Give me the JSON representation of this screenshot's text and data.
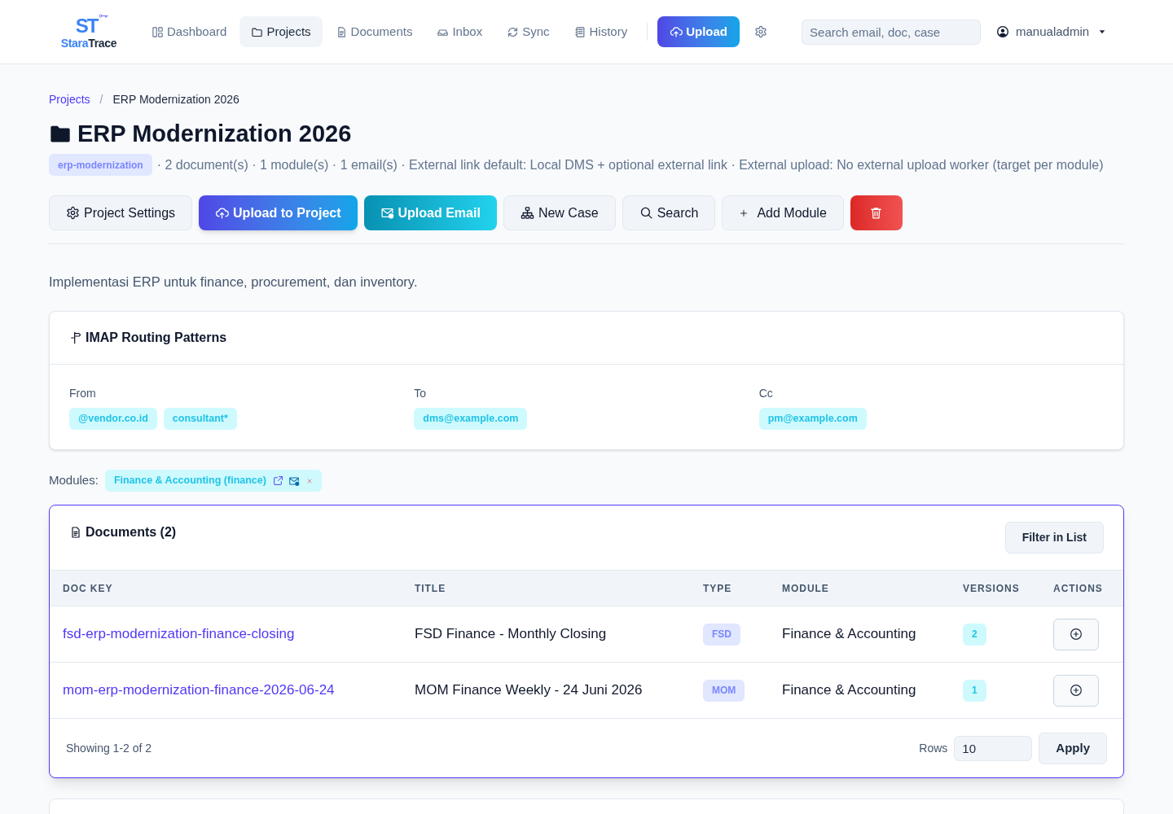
{
  "header": {
    "logo": {
      "mark": "ST",
      "name_parts": [
        {
          "text": "Stara",
          "accent": true
        },
        {
          "text": "Trace",
          "accent": false
        }
      ]
    },
    "nav": [
      {
        "kind": "dashboard",
        "label": "Dashboard",
        "selected": false
      },
      {
        "kind": "projects",
        "label": "Projects",
        "selected": true
      },
      {
        "kind": "documents",
        "label": "Documents",
        "selected": false
      },
      {
        "kind": "inbox",
        "label": "Inbox",
        "selected": false
      },
      {
        "kind": "sync",
        "label": "Sync",
        "selected": false
      },
      {
        "kind": "history",
        "label": "History",
        "selected": false
      }
    ],
    "upload_button": "Upload",
    "search": {
      "placeholder": "Search email, doc, case"
    },
    "user": {
      "name": "manualadmin"
    }
  },
  "breadcrumb": [
    {
      "label": "Projects",
      "current": false
    },
    {
      "label": "ERP Modernization 2026",
      "current": true
    }
  ],
  "breadcrumb_separator": "/",
  "project": {
    "title": "ERP Modernization 2026",
    "slug": "erp-modernization",
    "meta": "· 2 document(s) · 1 module(s) · 1 email(s) · External link default: Local DMS + optional external link · External upload: No external upload worker (target per module)"
  },
  "actions": [
    {
      "kind": "settings",
      "label": "Project Settings"
    },
    {
      "kind": "upload",
      "label": "Upload to Project"
    },
    {
      "kind": "email",
      "label": "Upload Email"
    },
    {
      "kind": "case",
      "label": "New Case"
    },
    {
      "kind": "search",
      "label": "Search"
    },
    {
      "kind": "add",
      "label": "Add Module"
    },
    {
      "kind": "delete"
    }
  ],
  "description": "Implementasi ERP untuk finance, procurement, dan inventory.",
  "imap": {
    "title": "IMAP Routing Patterns",
    "groups": [
      {
        "label": "From",
        "patterns": [
          "@vendor.co.id",
          "consultant*"
        ]
      },
      {
        "label": "To",
        "patterns": [
          "dms@example.com"
        ]
      },
      {
        "label": "Cc",
        "patterns": [
          "pm@example.com"
        ]
      }
    ]
  },
  "modules": {
    "label": "Modules:",
    "items": [
      {
        "label": "Finance & Accounting (finance)"
      }
    ]
  },
  "documents": {
    "title": "Documents (2)",
    "filter_button": "Filter in List",
    "columns": [
      "DOC KEY",
      "TITLE",
      "TYPE",
      "MODULE",
      "VERSIONS",
      "ACTIONS"
    ],
    "rows": [
      {
        "doc_key": "fsd-erp-modernization-finance-closing",
        "title": "FSD Finance - Monthly Closing",
        "type": "FSD",
        "module": "Finance & Accounting",
        "versions": "2"
      },
      {
        "doc_key": "mom-erp-modernization-finance-2026-06-24",
        "title": "MOM Finance Weekly - 24 Juni 2026",
        "type": "MOM",
        "module": "Finance & Accounting",
        "versions": "1"
      }
    ],
    "footer": {
      "summary": "Showing 1-2 of 2",
      "rows_label": "Rows",
      "rows_value": "10",
      "apply_button": "Apply"
    }
  }
}
